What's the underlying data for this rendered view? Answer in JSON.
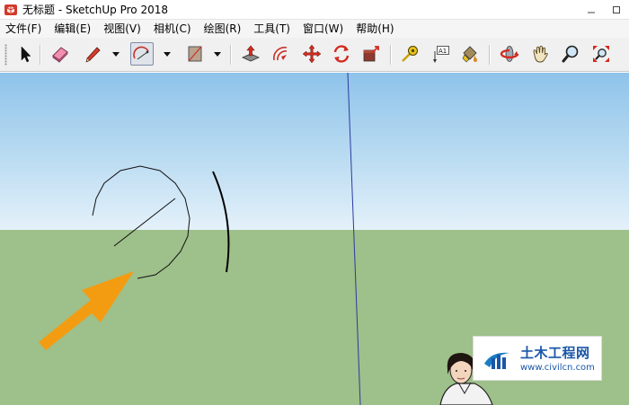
{
  "window": {
    "title": "无标题 - SketchUp Pro 2018",
    "app_icon": "sketchup-logo-icon",
    "controls": [
      "minimize-icon",
      "maximize-icon",
      "close-icon"
    ]
  },
  "menubar": {
    "items": [
      "文件(F)",
      "编辑(E)",
      "视图(V)",
      "相机(C)",
      "绘图(R)",
      "工具(T)",
      "窗口(W)",
      "帮助(H)"
    ]
  },
  "toolbar": {
    "tools": [
      {
        "icon": "select-arrow-icon"
      },
      {
        "icon": "eraser-icon"
      },
      {
        "icon": "pencil-line-icon",
        "dropdown": true
      },
      {
        "icon": "arc-icon",
        "dropdown": true,
        "active": true
      },
      {
        "icon": "rectangle-shape-icon",
        "dropdown": true
      },
      {
        "icon": "push-pull-icon"
      },
      {
        "icon": "offset-icon"
      },
      {
        "icon": "move-icon"
      },
      {
        "icon": "rotate-icon"
      },
      {
        "icon": "scale-icon"
      },
      {
        "icon": "tape-measure-icon"
      },
      {
        "icon": "text-label-icon"
      },
      {
        "icon": "paint-bucket-icon"
      },
      {
        "icon": "orbit-icon"
      },
      {
        "icon": "pan-hand-icon"
      },
      {
        "icon": "zoom-icon"
      },
      {
        "icon": "zoom-extents-icon"
      }
    ],
    "text_tool_label": "A1"
  },
  "scene": {
    "sky_color": "#a9d2f0",
    "ground_color": "#9ec08a",
    "axis_color": "#2b3aa0",
    "annotation_arrow_color": "#f39c12",
    "objects": [
      "arc-in-progress",
      "completed-arc",
      "pointer-arrow",
      "user-avatar"
    ]
  },
  "watermark": {
    "title": "土木工程网",
    "url": "www.civilcn.com",
    "color": "#1a56a8"
  }
}
